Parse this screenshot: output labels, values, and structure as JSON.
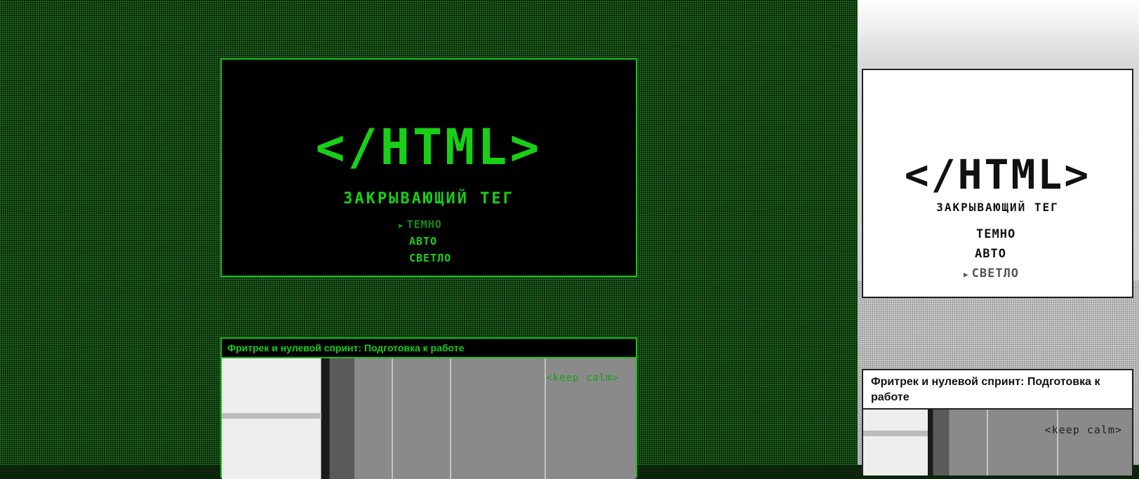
{
  "site": {
    "logo": "</HTML>",
    "subtitle": "ЗАКРЫВАЮЩИЙ ТЕГ"
  },
  "themes": {
    "arrow": "▶",
    "items": [
      "ТЕМНО",
      "АВТО",
      "СВЕТЛО"
    ],
    "selected_dark": "ТЕМНО",
    "selected_light": "СВЕТЛО"
  },
  "article": {
    "title": "Фритрек и нулевой спринт: Подготовка к работе",
    "image_caption": "<keep calm>"
  },
  "colors": {
    "accent_green": "#17d017",
    "dark_bg": "#000000",
    "light_bg": "#ffffff",
    "light_text": "#111111"
  }
}
